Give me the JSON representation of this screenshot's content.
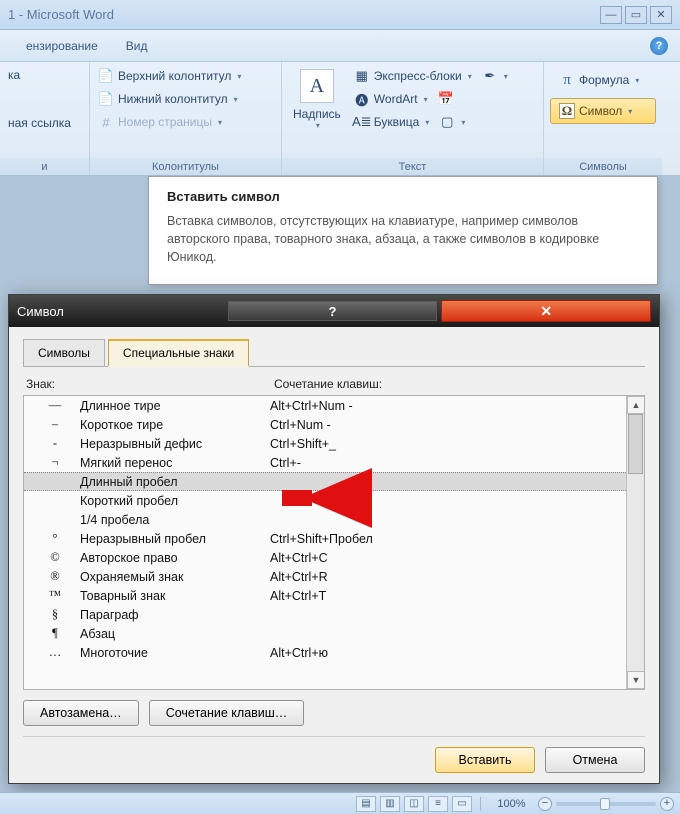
{
  "window": {
    "title": "1 - Microsoft Word"
  },
  "tabs": {
    "review": "ензирование",
    "view": "Вид"
  },
  "ribbon": {
    "links": {
      "ka": "ка",
      "cross_ref": "ная ссылка",
      "group_label": "и"
    },
    "headerfooter": {
      "header": "Верхний колонтитул",
      "footer": "Нижний колонтитул",
      "page_number": "Номер страницы",
      "group_label": "Колонтитулы"
    },
    "text": {
      "text_box": "Надпись",
      "quick_parts": "Экспресс-блоки",
      "wordart": "WordArt",
      "drop_cap": "Буквица",
      "group_label": "Текст"
    },
    "symbols": {
      "equation": "Формула",
      "symbol": "Символ",
      "group_label": "Символы"
    }
  },
  "tooltip": {
    "title": "Вставить символ",
    "body": "Вставка символов, отсутствующих на клавиатуре, например символов авторского права, товарного знака, абзаца, а также символов в кодировке Юникод."
  },
  "dialog": {
    "title": "Символ",
    "tab_symbols": "Символы",
    "tab_special": "Специальные знаки",
    "header_char": "Знак:",
    "header_shortcut": "Сочетание клавиш:",
    "rows": [
      {
        "glyph": "—",
        "name": "Длинное тире",
        "shortcut": "Alt+Ctrl+Num -",
        "selected": false
      },
      {
        "glyph": "–",
        "name": "Короткое тире",
        "shortcut": "Ctrl+Num -",
        "selected": false
      },
      {
        "glyph": "-",
        "name": "Неразрывный дефис",
        "shortcut": "Ctrl+Shift+_",
        "selected": false
      },
      {
        "glyph": "¬",
        "name": "Мягкий перенос",
        "shortcut": "Ctrl+-",
        "selected": false
      },
      {
        "glyph": "",
        "name": "Длинный пробел",
        "shortcut": "",
        "selected": true
      },
      {
        "glyph": "",
        "name": "Короткий пробел",
        "shortcut": "",
        "selected": false
      },
      {
        "glyph": "",
        "name": "1/4 пробела",
        "shortcut": "",
        "selected": false
      },
      {
        "glyph": "°",
        "name": "Неразрывный пробел",
        "shortcut": "Ctrl+Shift+Пробел",
        "selected": false
      },
      {
        "glyph": "©",
        "name": "Авторское право",
        "shortcut": "Alt+Ctrl+C",
        "selected": false
      },
      {
        "glyph": "®",
        "name": "Охраняемый знак",
        "shortcut": "Alt+Ctrl+R",
        "selected": false
      },
      {
        "glyph": "™",
        "name": "Товарный знак",
        "shortcut": "Alt+Ctrl+T",
        "selected": false
      },
      {
        "glyph": "§",
        "name": "Параграф",
        "shortcut": "",
        "selected": false
      },
      {
        "glyph": "¶",
        "name": "Абзац",
        "shortcut": "",
        "selected": false
      },
      {
        "glyph": "…",
        "name": "Многоточие",
        "shortcut": "Alt+Ctrl+ю",
        "selected": false
      }
    ],
    "autocorrect": "Автозамена…",
    "shortcut_btn": "Сочетание клавиш…",
    "insert": "Вставить",
    "cancel": "Отмена"
  },
  "status": {
    "zoom": "100%"
  }
}
